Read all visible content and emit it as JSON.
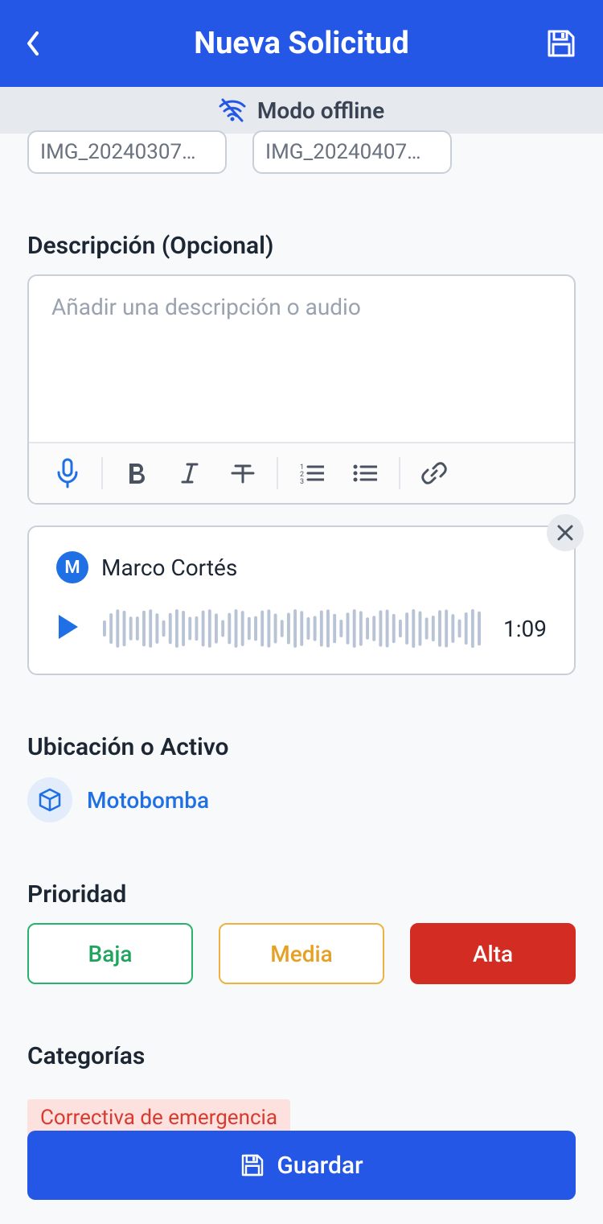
{
  "header": {
    "title": "Nueva Solicitud"
  },
  "offline": {
    "label": "Modo offline"
  },
  "attachments": [
    "IMG_20240307…",
    "IMG_20240407…"
  ],
  "sections": {
    "description_label": "Descripción (Opcional)",
    "location_label": "Ubicación o Activo",
    "priority_label": "Prioridad",
    "categories_label": "Categorías"
  },
  "editor": {
    "placeholder": "Añadir una descripción o audio"
  },
  "audio": {
    "user_initial": "M",
    "user_name": "Marco Cortés",
    "duration": "1:09"
  },
  "asset": {
    "name": "Motobomba"
  },
  "priority": {
    "low": "Baja",
    "med": "Media",
    "high": "Alta",
    "selected": "high"
  },
  "category": {
    "chip": "Correctiva de emergencia"
  },
  "footer": {
    "save_label": "Guardar"
  },
  "colors": {
    "primary": "#2457e6",
    "green": "#27b36a",
    "orange": "#f0b23e",
    "red": "#d32c22"
  }
}
